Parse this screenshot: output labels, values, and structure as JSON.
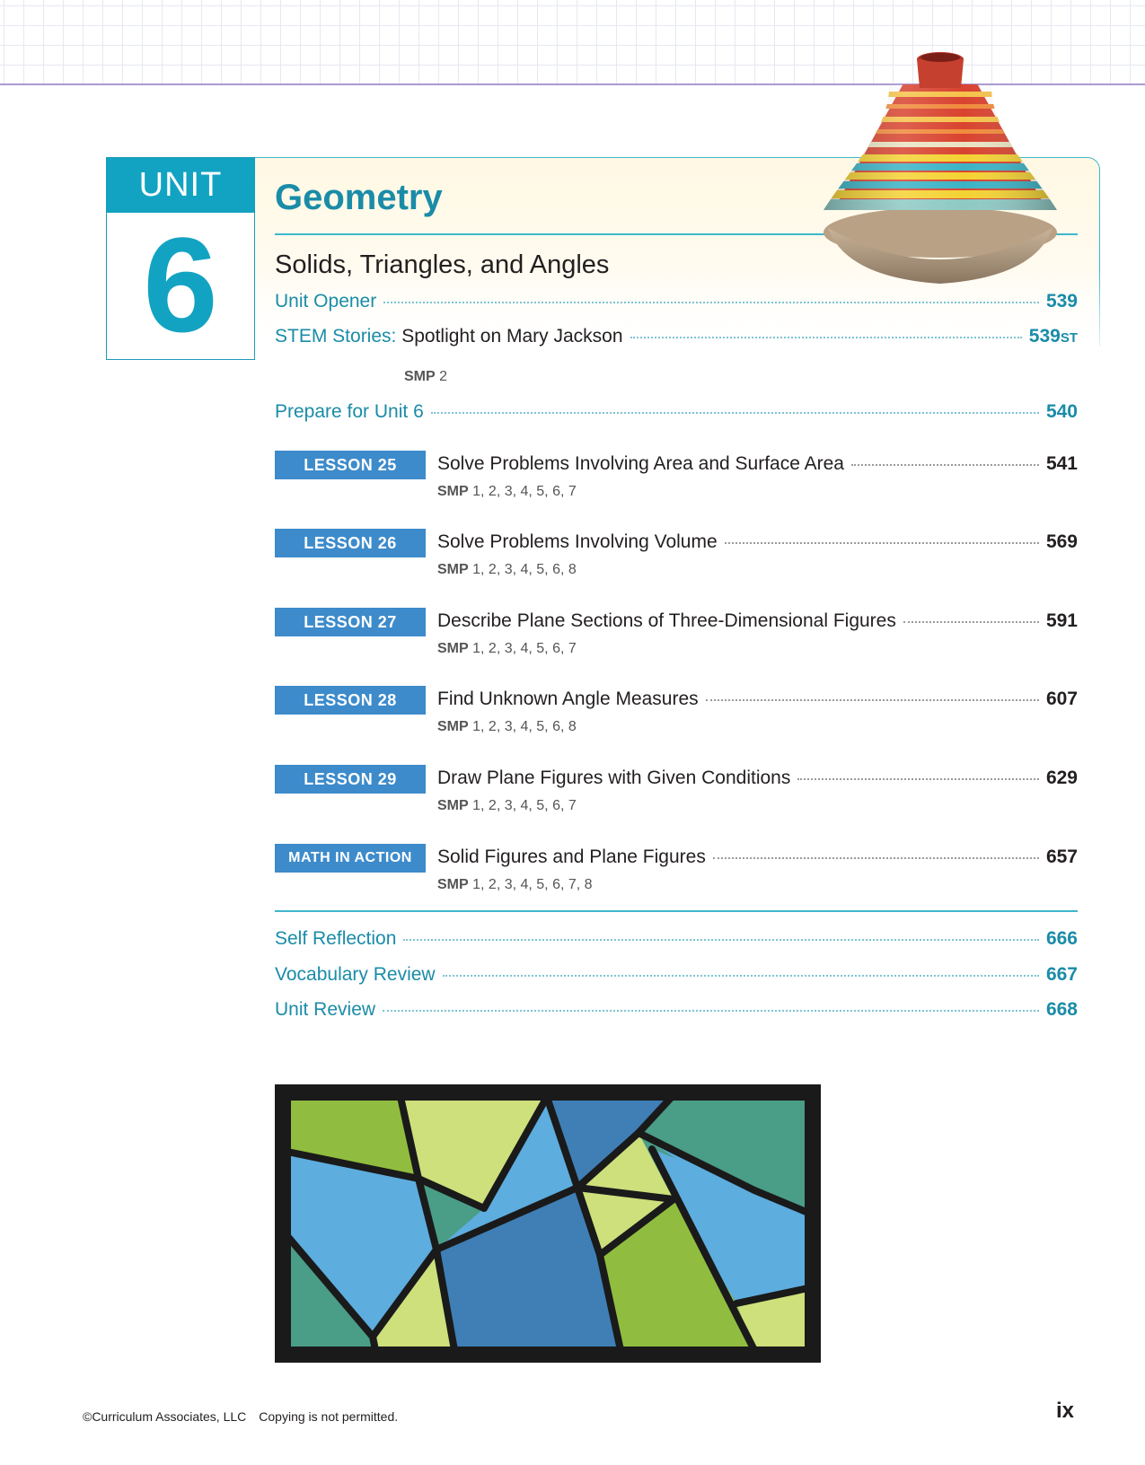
{
  "unit": {
    "label": "UNIT",
    "number": "6"
  },
  "title": "Geometry",
  "subtitle": "Solids, Triangles, and Angles",
  "front": {
    "unit_opener": {
      "label": "Unit Opener",
      "page": "539"
    },
    "stem": {
      "prefix": "STEM Stories:",
      "text": "Spotlight on Mary Jackson",
      "page": "539",
      "page_suffix": "ST",
      "smp_label": "SMP",
      "smp": "2"
    },
    "prepare": {
      "label": "Prepare for Unit 6",
      "page": "540"
    }
  },
  "lessons": [
    {
      "tag": "LESSON 25",
      "title": "Solve Problems Involving Area and Surface Area",
      "page": "541",
      "smp_label": "SMP",
      "smp": "1, 2, 3, 4, 5, 6, 7"
    },
    {
      "tag": "LESSON 26",
      "title": "Solve Problems Involving Volume",
      "page": "569",
      "smp_label": "SMP",
      "smp": "1, 2, 3, 4, 5, 6, 8"
    },
    {
      "tag": "LESSON 27",
      "title": "Describe Plane Sections of Three-Dimensional Figures",
      "page": "591",
      "smp_label": "SMP",
      "smp": "1, 2, 3, 4, 5, 6, 7"
    },
    {
      "tag": "LESSON 28",
      "title": "Find Unknown Angle Measures",
      "page": "607",
      "smp_label": "SMP",
      "smp": "1, 2, 3, 4, 5, 6, 8"
    },
    {
      "tag": "LESSON 29",
      "title": "Draw Plane Figures with Given Conditions",
      "page": "629",
      "smp_label": "SMP",
      "smp": "1, 2, 3, 4, 5, 6, 7"
    },
    {
      "tag": "MATH IN ACTION",
      "title": "Solid Figures and Plane Figures",
      "page": "657",
      "smp_label": "SMP",
      "smp": "1, 2, 3, 4, 5, 6, 7, 8"
    }
  ],
  "back": [
    {
      "label": "Self Reflection",
      "page": "666"
    },
    {
      "label": "Vocabulary Review",
      "page": "667"
    },
    {
      "label": "Unit Review",
      "page": "668"
    }
  ],
  "footer": {
    "copyright": "©Curriculum Associates, LLC",
    "notice": "Copying is not permitted."
  },
  "page_number": "ix",
  "images": {
    "top_right": "tagine-pot-photo",
    "bottom": "stained-glass-geometric-panel"
  },
  "colors": {
    "teal": "#1a8ca8",
    "unit_teal": "#13a3c2",
    "lesson_blue": "#3d8bcb",
    "rule": "#3fb6cd"
  }
}
